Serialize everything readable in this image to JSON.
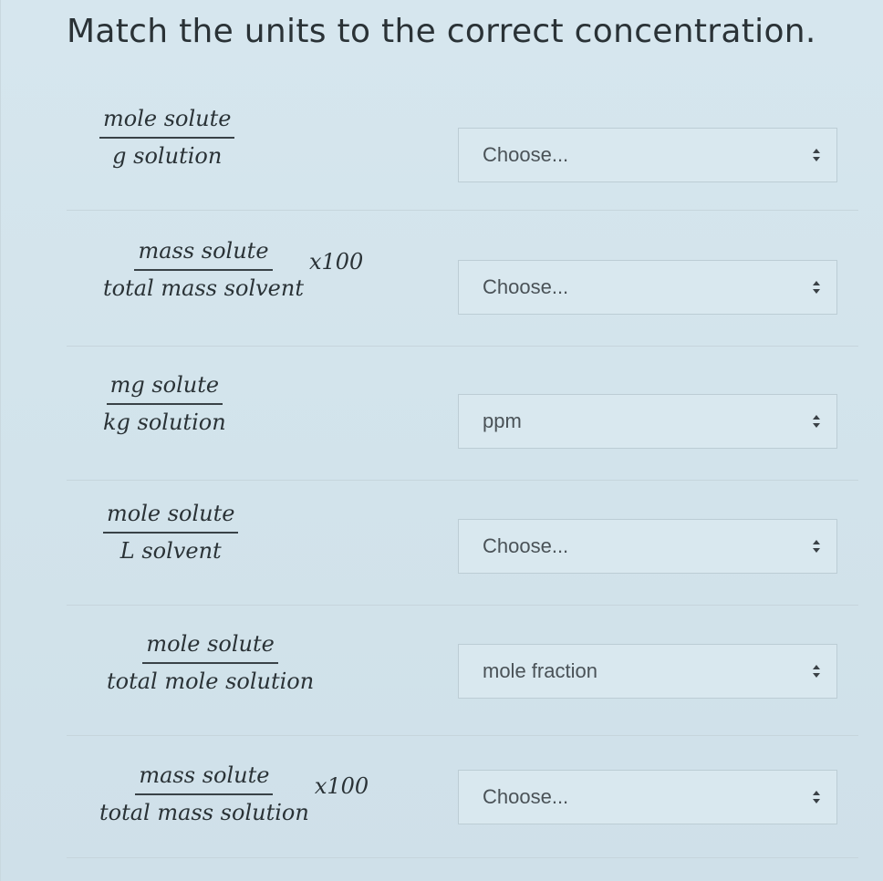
{
  "title": "Match the units to the correct concentration.",
  "rows": [
    {
      "numerator": "mole solute",
      "denominator": "g solution",
      "multiplier": "",
      "select_value": "Choose..."
    },
    {
      "numerator": "mass solute",
      "denominator": "total mass solvent",
      "multiplier": "x100",
      "select_value": "Choose..."
    },
    {
      "numerator": "mg solute",
      "denominator": "kg solution",
      "multiplier": "",
      "select_value": "ppm"
    },
    {
      "numerator": "mole solute",
      "denominator": "L solvent",
      "multiplier": "",
      "select_value": "Choose..."
    },
    {
      "numerator": "mole solute",
      "denominator": "total mole solution",
      "multiplier": "",
      "select_value": "mole fraction"
    },
    {
      "numerator": "mass solute",
      "denominator": "total mass solution",
      "multiplier": "x100",
      "select_value": "Choose..."
    }
  ],
  "icons": {
    "select_arrow": "up-down-arrow-icon"
  },
  "colors": {
    "background": "#d6e6ee",
    "select_background": "#d9e8ef",
    "select_border": "#bccdd5",
    "text": "#2a3236"
  }
}
